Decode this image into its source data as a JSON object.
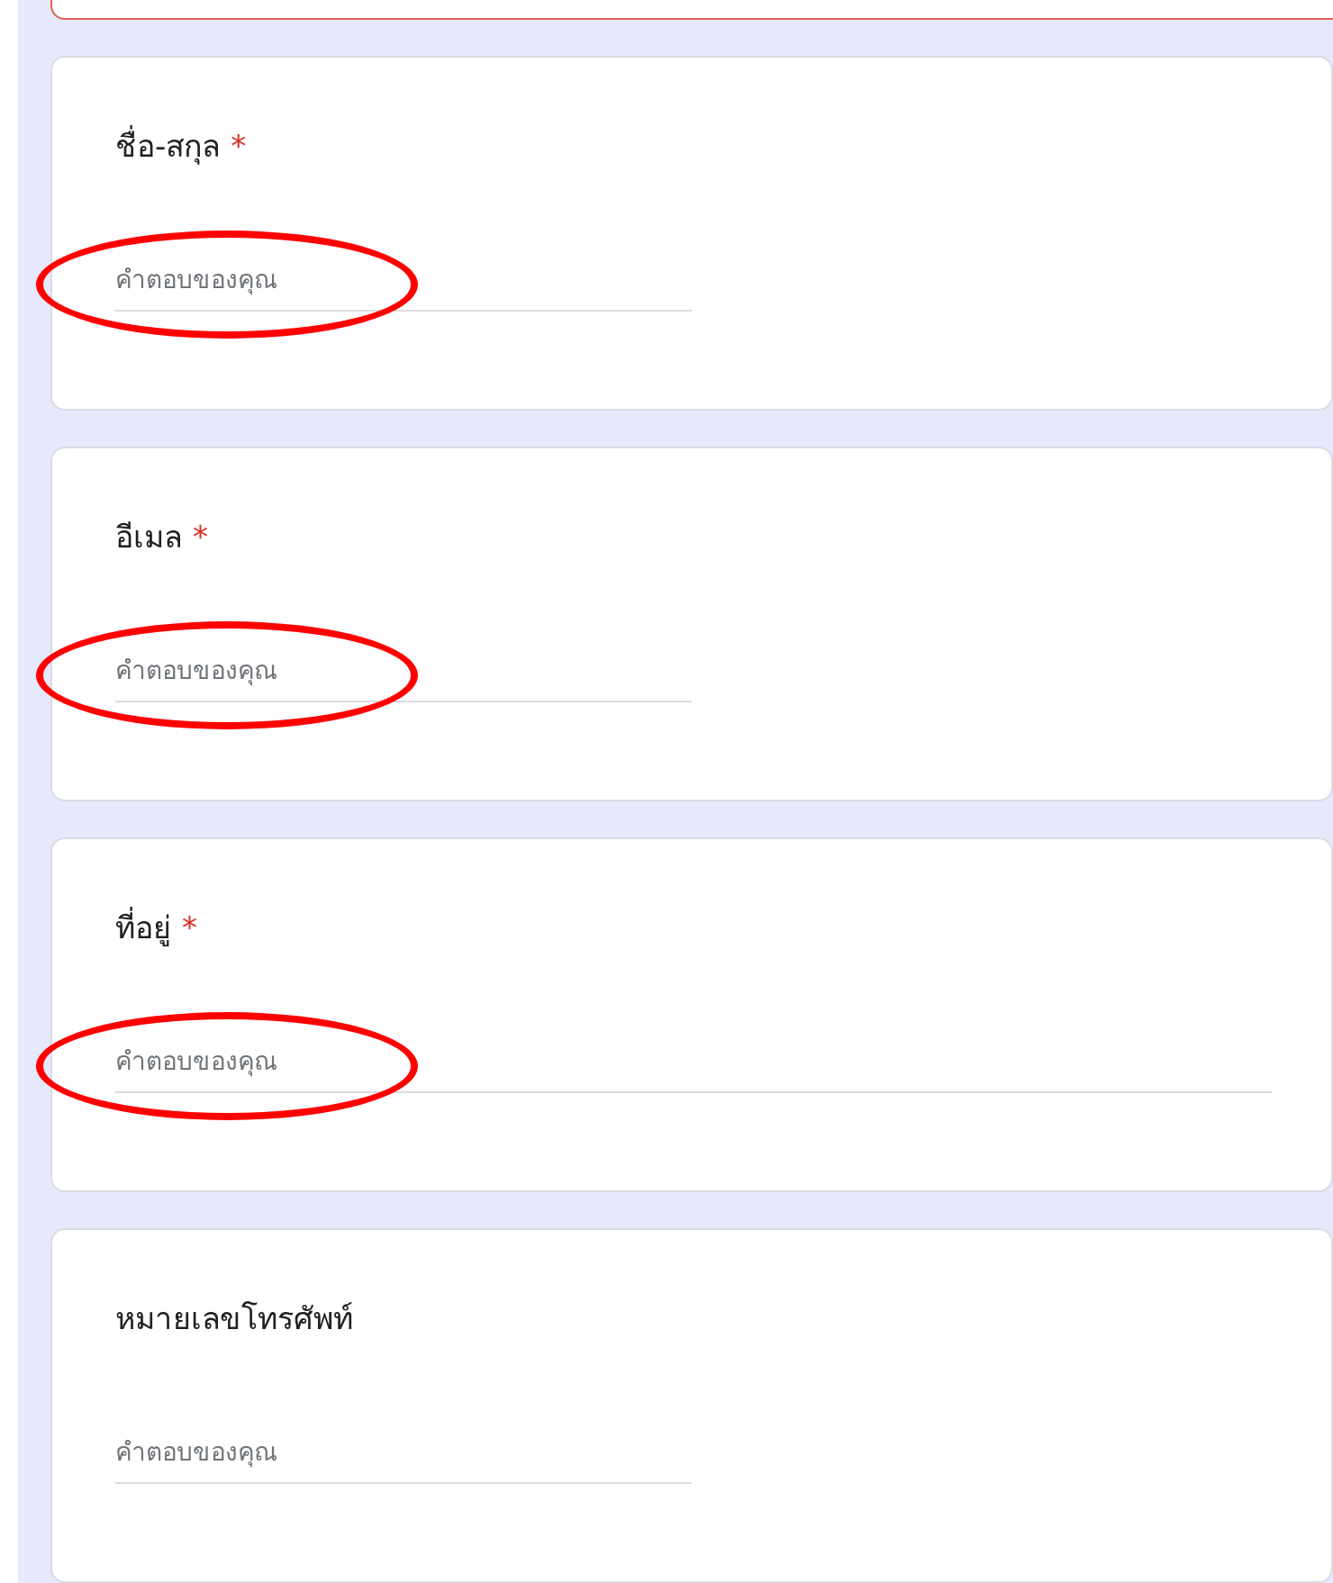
{
  "previous_card": {
    "error": true
  },
  "questions": [
    {
      "title": "ชื่อ-สกุล",
      "required_mark": "*",
      "placeholder": "คำตอบของคุณ",
      "kind": "short",
      "circled": true
    },
    {
      "title": "อีเมล",
      "required_mark": "*",
      "placeholder": "คำตอบของคุณ",
      "kind": "short",
      "circled": true
    },
    {
      "title": "ที่อยู่",
      "required_mark": "*",
      "placeholder": "คำตอบของคุณ",
      "kind": "long",
      "circled": true
    },
    {
      "title": "หมายเลขโทรศัพท์",
      "placeholder": "คำตอบของคุณ",
      "kind": "short",
      "circled": false
    }
  ]
}
